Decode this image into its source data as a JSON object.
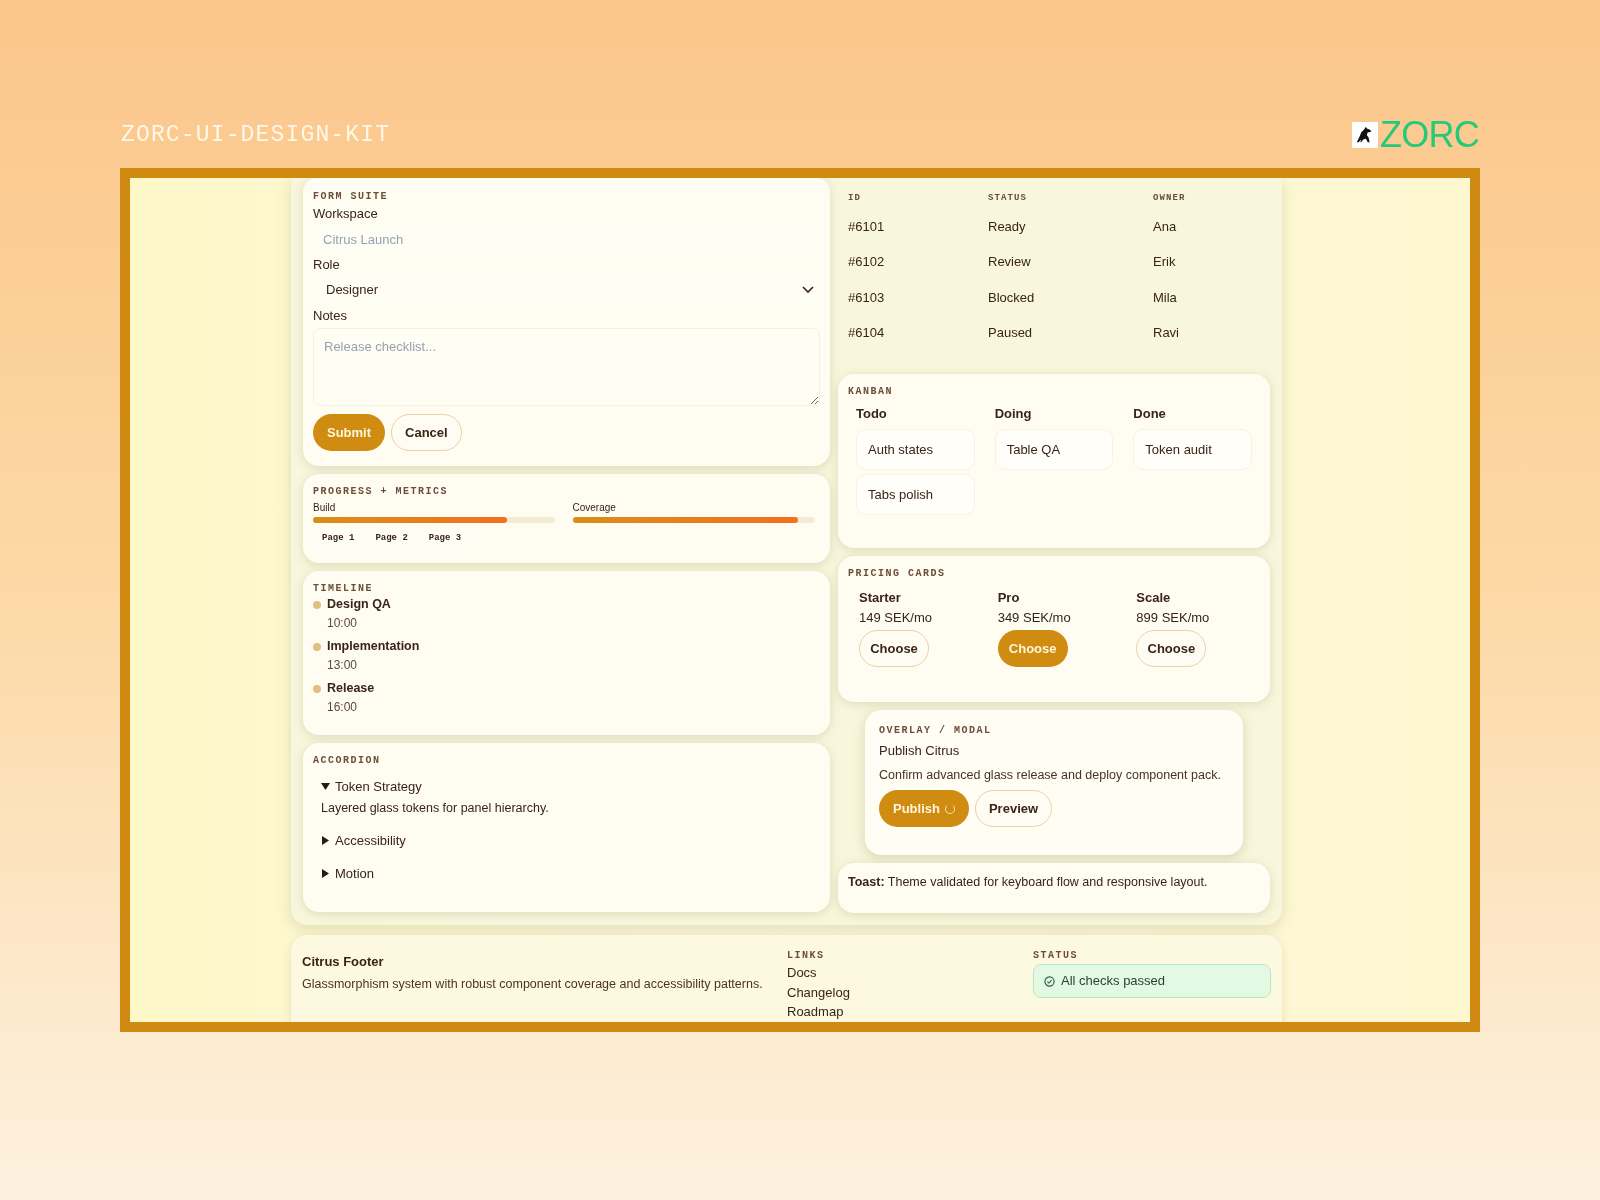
{
  "header": {
    "title": "ZORC-UI-DESIGN-KIT",
    "logo_text": "ZORC"
  },
  "form": {
    "label": "FORM SUITE",
    "fields": [
      {
        "kind": "text",
        "label": "Workspace",
        "placeholder": "Citrus Launch"
      },
      {
        "kind": "select",
        "label": "Role",
        "value": "Designer"
      },
      {
        "kind": "textarea",
        "label": "Notes",
        "placeholder": "Release checklist..."
      }
    ],
    "buttons": [
      {
        "label": "Submit",
        "kind": "primary"
      },
      {
        "label": "Cancel",
        "kind": "secondary"
      }
    ]
  },
  "progress": {
    "label": "PROGRESS + METRICS",
    "meters": [
      {
        "name": "Build",
        "level": 0.8
      },
      {
        "name": "Coverage",
        "level": 0.93
      }
    ],
    "pages": [
      "Page 1",
      "Page 2",
      "Page 3"
    ]
  },
  "timeline": {
    "label": "TIMELINE",
    "events": [
      {
        "title": "Design QA",
        "time": "10:00"
      },
      {
        "title": "Implementation",
        "time": "13:00"
      },
      {
        "title": "Release",
        "time": "16:00"
      }
    ]
  },
  "accordion": {
    "label": "ACCORDION",
    "items": [
      {
        "title": "Token Strategy",
        "expanded": true,
        "body": "Layered glass tokens for panel hierarchy."
      },
      {
        "title": "Accessibility",
        "expanded": false
      },
      {
        "title": "Motion",
        "expanded": false
      }
    ]
  },
  "table": {
    "columns": [
      "ID",
      "STATUS",
      "OWNER"
    ],
    "rows": [
      [
        "#6101",
        "Ready",
        "Ana"
      ],
      [
        "#6102",
        "Review",
        "Erik"
      ],
      [
        "#6103",
        "Blocked",
        "Mila"
      ],
      [
        "#6104",
        "Paused",
        "Ravi"
      ]
    ]
  },
  "kanban": {
    "label": "KANBAN",
    "columns": [
      {
        "title": "Todo",
        "cards": [
          "Auth states",
          "Tabs polish"
        ]
      },
      {
        "title": "Doing",
        "cards": [
          "Table QA"
        ]
      },
      {
        "title": "Done",
        "cards": [
          "Token audit"
        ]
      }
    ]
  },
  "pricing": {
    "label": "PRICING CARDS",
    "plans": [
      {
        "name": "Starter",
        "price": "149 SEK/mo",
        "button": "Choose",
        "highlighted": false
      },
      {
        "name": "Pro",
        "price": "349 SEK/mo",
        "button": "Choose",
        "highlighted": true
      },
      {
        "name": "Scale",
        "price": "899 SEK/mo",
        "button": "Choose",
        "highlighted": false
      }
    ]
  },
  "modal": {
    "label": "OVERLAY / MODAL",
    "title": "Publish Citrus",
    "text": "Confirm advanced glass release and deploy component pack.",
    "buttons": [
      {
        "label": "Publish",
        "kind": "primary",
        "loading": true
      },
      {
        "label": "Preview",
        "kind": "secondary",
        "loading": false
      }
    ]
  },
  "toast": {
    "text": "**Toast:** Theme validated for keyboard flow and responsive layout."
  },
  "footer": {
    "title": "Citrus Footer",
    "description": "Glassmorphism system with robust component coverage and accessibility patterns.",
    "links_label": "LINKS",
    "links": [
      "Docs",
      "Changelog",
      "Roadmap"
    ],
    "status_label": "STATUS",
    "status": "All checks passed"
  }
}
